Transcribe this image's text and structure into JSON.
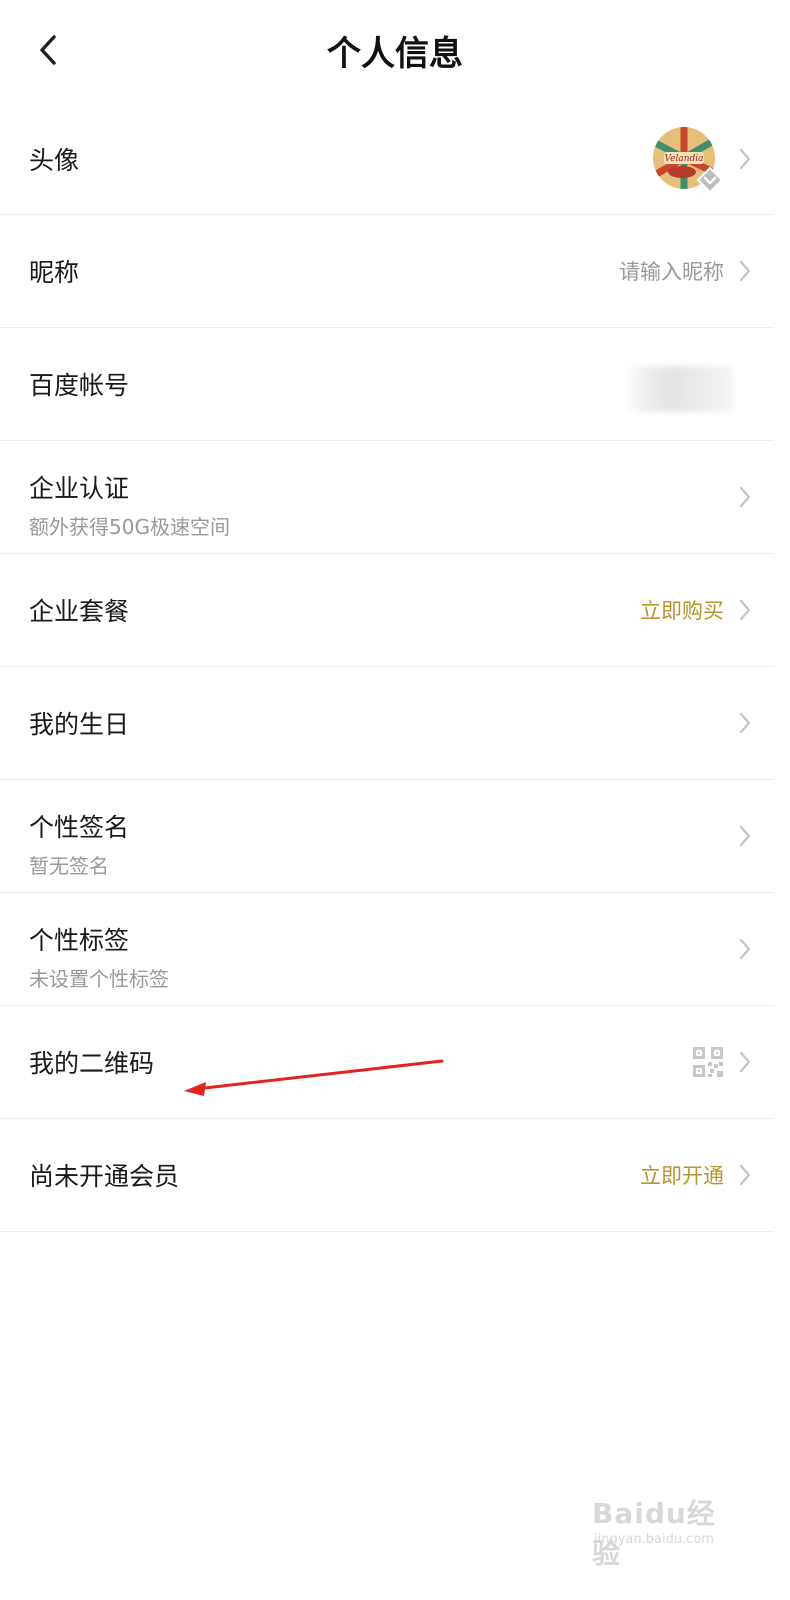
{
  "header": {
    "title": "个人信息"
  },
  "rows": [
    {
      "label": "头像"
    },
    {
      "label": "昵称",
      "value": "请输入昵称"
    },
    {
      "label": "百度帐号"
    },
    {
      "label": "企业认证",
      "sub": "额外获得50G极速空间"
    },
    {
      "label": "企业套餐",
      "value": "立即购买"
    },
    {
      "label": "我的生日"
    },
    {
      "label": "个性签名",
      "sub": "暂无签名"
    },
    {
      "label": "个性标签",
      "sub": "未设置个性标签"
    },
    {
      "label": "我的二维码"
    },
    {
      "label": "尚未开通会员",
      "value": "立即开通"
    }
  ],
  "watermark": {
    "text": "Baidu经验",
    "url": "jingyan.baidu.com"
  },
  "colors": {
    "accent_gold": "#b8952e",
    "arrow_red": "#e4231f"
  },
  "icons": [
    "back-arrow-icon",
    "chevron-right-icon",
    "qr-code-icon",
    "avatar-verified-badge-icon"
  ]
}
